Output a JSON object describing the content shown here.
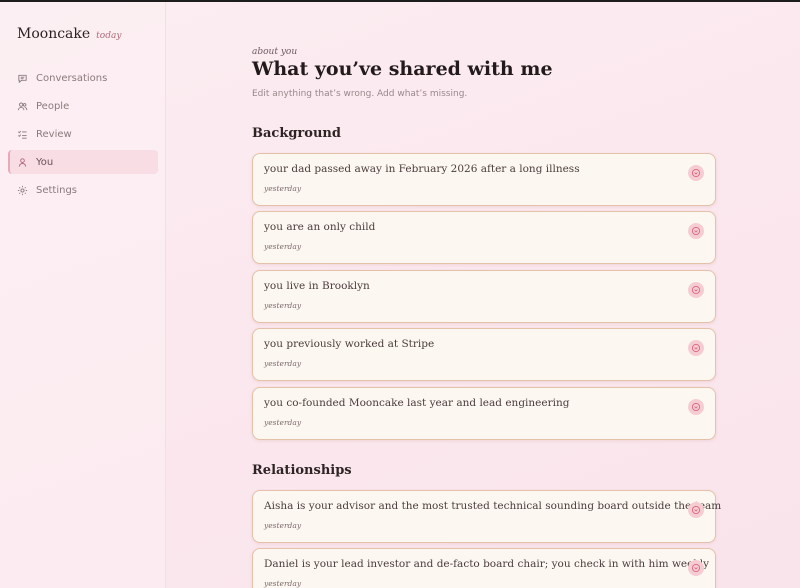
{
  "brand": {
    "name": "Mooncake",
    "tag": "today"
  },
  "nav": {
    "items": [
      {
        "label": "Conversations",
        "icon": "chat-icon"
      },
      {
        "label": "People",
        "icon": "people-icon"
      },
      {
        "label": "Review",
        "icon": "checklist-icon"
      },
      {
        "label": "You",
        "icon": "person-icon",
        "active": true
      },
      {
        "label": "Settings",
        "icon": "gear-icon"
      }
    ]
  },
  "header": {
    "eyebrow": "about you",
    "title": "What you’ve shared with me",
    "subtitle": "Edit anything that’s wrong. Add what’s missing."
  },
  "sections": [
    {
      "title": "Background",
      "items": [
        {
          "text": "your dad passed away in February 2026 after a long illness",
          "meta": "yesterday"
        },
        {
          "text": "you are an only child",
          "meta": "yesterday"
        },
        {
          "text": "you live in Brooklyn",
          "meta": "yesterday"
        },
        {
          "text": "you previously worked at Stripe",
          "meta": "yesterday"
        },
        {
          "text": "you co-founded Mooncake last year and lead engineering",
          "meta": "yesterday"
        }
      ]
    },
    {
      "title": "Relationships",
      "items": [
        {
          "text": "Aisha is your advisor and the most trusted technical sounding board outside the team",
          "meta": "yesterday"
        },
        {
          "text": "Daniel is your lead investor and de-facto board chair; you check in with him weekly",
          "meta": "yesterday"
        }
      ]
    }
  ],
  "colors": {
    "accent": "#e8a9b9",
    "card_border": "#e4c1a9",
    "card_bg": "#fdf7f1",
    "delete_bg": "#f6ccd3",
    "delete_icon": "#d9667f"
  }
}
